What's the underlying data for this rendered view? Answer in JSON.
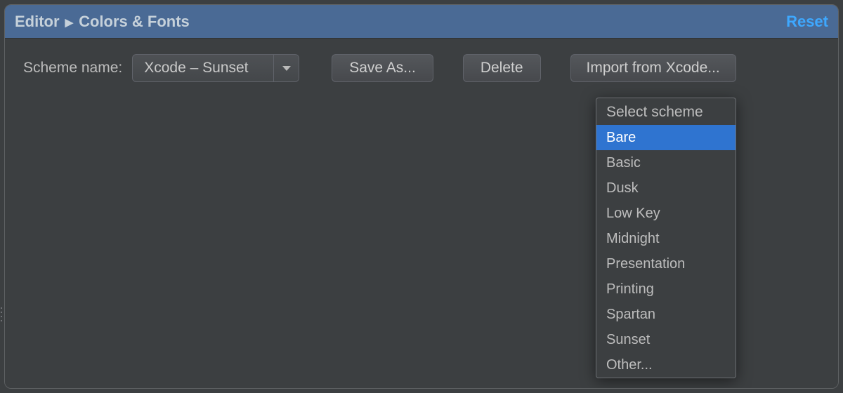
{
  "header": {
    "crumb1": "Editor",
    "crumb2": "Colors & Fonts",
    "reset": "Reset"
  },
  "row": {
    "label": "Scheme name:",
    "combo_value": "Xcode – Sunset",
    "save_as": "Save As...",
    "delete": "Delete",
    "import": "Import from Xcode..."
  },
  "dropdown": {
    "title": "Select scheme",
    "items": [
      "Bare",
      "Basic",
      "Dusk",
      "Low Key",
      "Midnight",
      "Presentation",
      "Printing",
      "Spartan",
      "Sunset",
      "Other..."
    ],
    "selected_index": 0
  }
}
